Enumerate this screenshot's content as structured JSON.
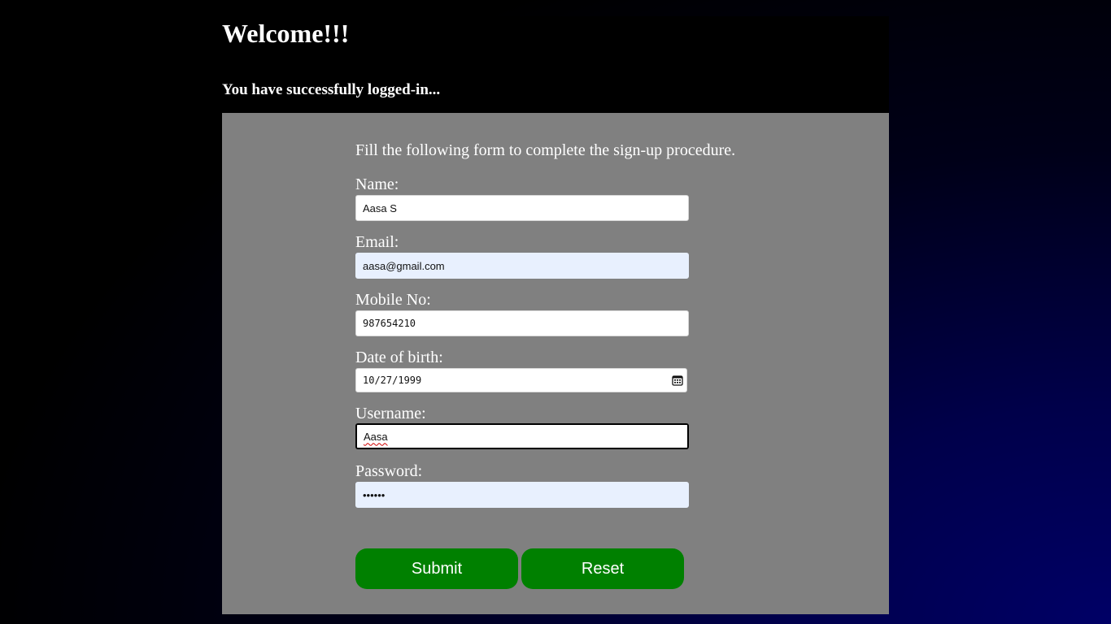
{
  "header": {
    "title": "Welcome!!!",
    "subtitle": "You have successfully logged-in..."
  },
  "form": {
    "intro": "Fill the following form to complete the sign-up procedure.",
    "fields": {
      "name": {
        "label": "Name:",
        "value": "Aasa S"
      },
      "email": {
        "label": "Email:",
        "value": "aasa@gmail.com"
      },
      "mobile": {
        "label": "Mobile No:",
        "value": "987654210"
      },
      "dob": {
        "label": "Date of birth:",
        "value": "10/27/1999",
        "icon": "calendar-icon"
      },
      "username": {
        "label": "Username:",
        "value": "Aasa"
      },
      "password": {
        "label": "Password:",
        "value": "••••••"
      }
    },
    "buttons": {
      "submit": "Submit",
      "reset": "Reset"
    }
  },
  "colors": {
    "header_bg": "#000000",
    "panel_bg": "#808080",
    "button_bg": "#008000",
    "autofill_bg": "#e8f0fe"
  }
}
